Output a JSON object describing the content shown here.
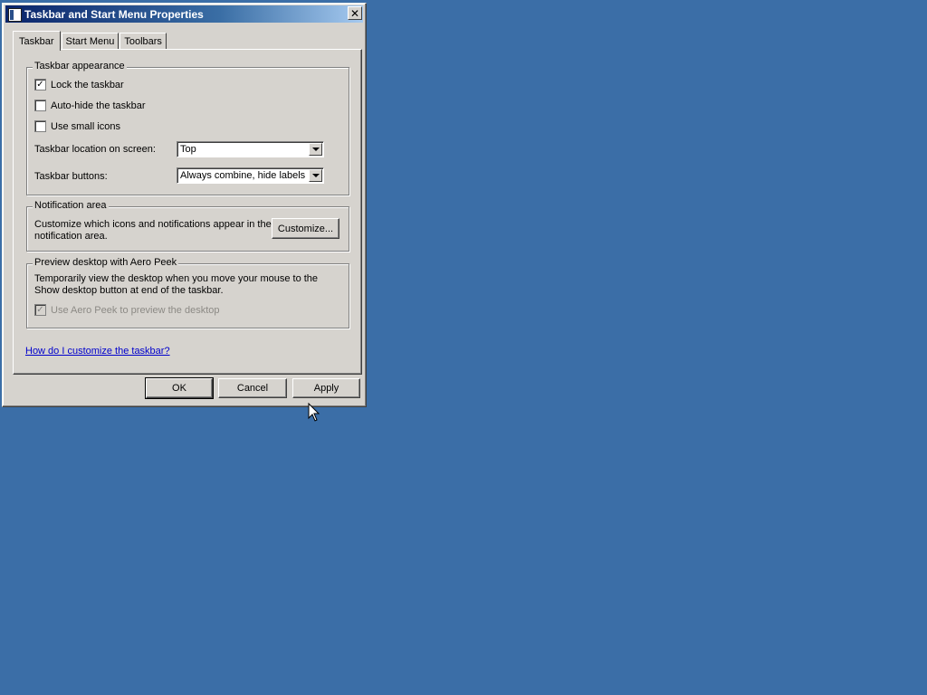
{
  "dialog": {
    "title": "Taskbar and Start Menu Properties",
    "close_symbol": "✕"
  },
  "tabs": [
    {
      "label": "Taskbar",
      "active": true
    },
    {
      "label": "Start Menu",
      "active": false
    },
    {
      "label": "Toolbars",
      "active": false
    }
  ],
  "appearance": {
    "group_title": "Taskbar appearance",
    "lock_label": "Lock the taskbar",
    "lock_checked": true,
    "autohide_label": "Auto-hide the taskbar",
    "autohide_checked": false,
    "small_icons_label": "Use small icons",
    "small_icons_checked": false,
    "location_label": "Taskbar location on screen:",
    "location_value": "Top",
    "buttons_label": "Taskbar buttons:",
    "buttons_value": "Always combine, hide labels"
  },
  "notification": {
    "group_title": "Notification area",
    "description": "Customize which icons and notifications appear in the notification area.",
    "customize_label": "Customize..."
  },
  "aero_peek": {
    "group_title": "Preview desktop with Aero Peek",
    "description": "Temporarily view the desktop when you move your mouse to the Show desktop button at end of the taskbar.",
    "checkbox_label": "Use Aero Peek to preview the desktop",
    "checked": true,
    "enabled": false
  },
  "help_link": "How do I customize the taskbar?",
  "footer": {
    "ok_label": "OK",
    "cancel_label": "Cancel",
    "apply_label": "Apply"
  },
  "colors": {
    "desktop": "#3b6ea7",
    "dialog_face": "#d6d3ce",
    "title_gradient_start": "#0a246a",
    "link": "#0000cc"
  },
  "icons": {
    "title_icon": "taskbar-properties-icon",
    "check": "✓",
    "cursor": "mouse-pointer-icon"
  }
}
